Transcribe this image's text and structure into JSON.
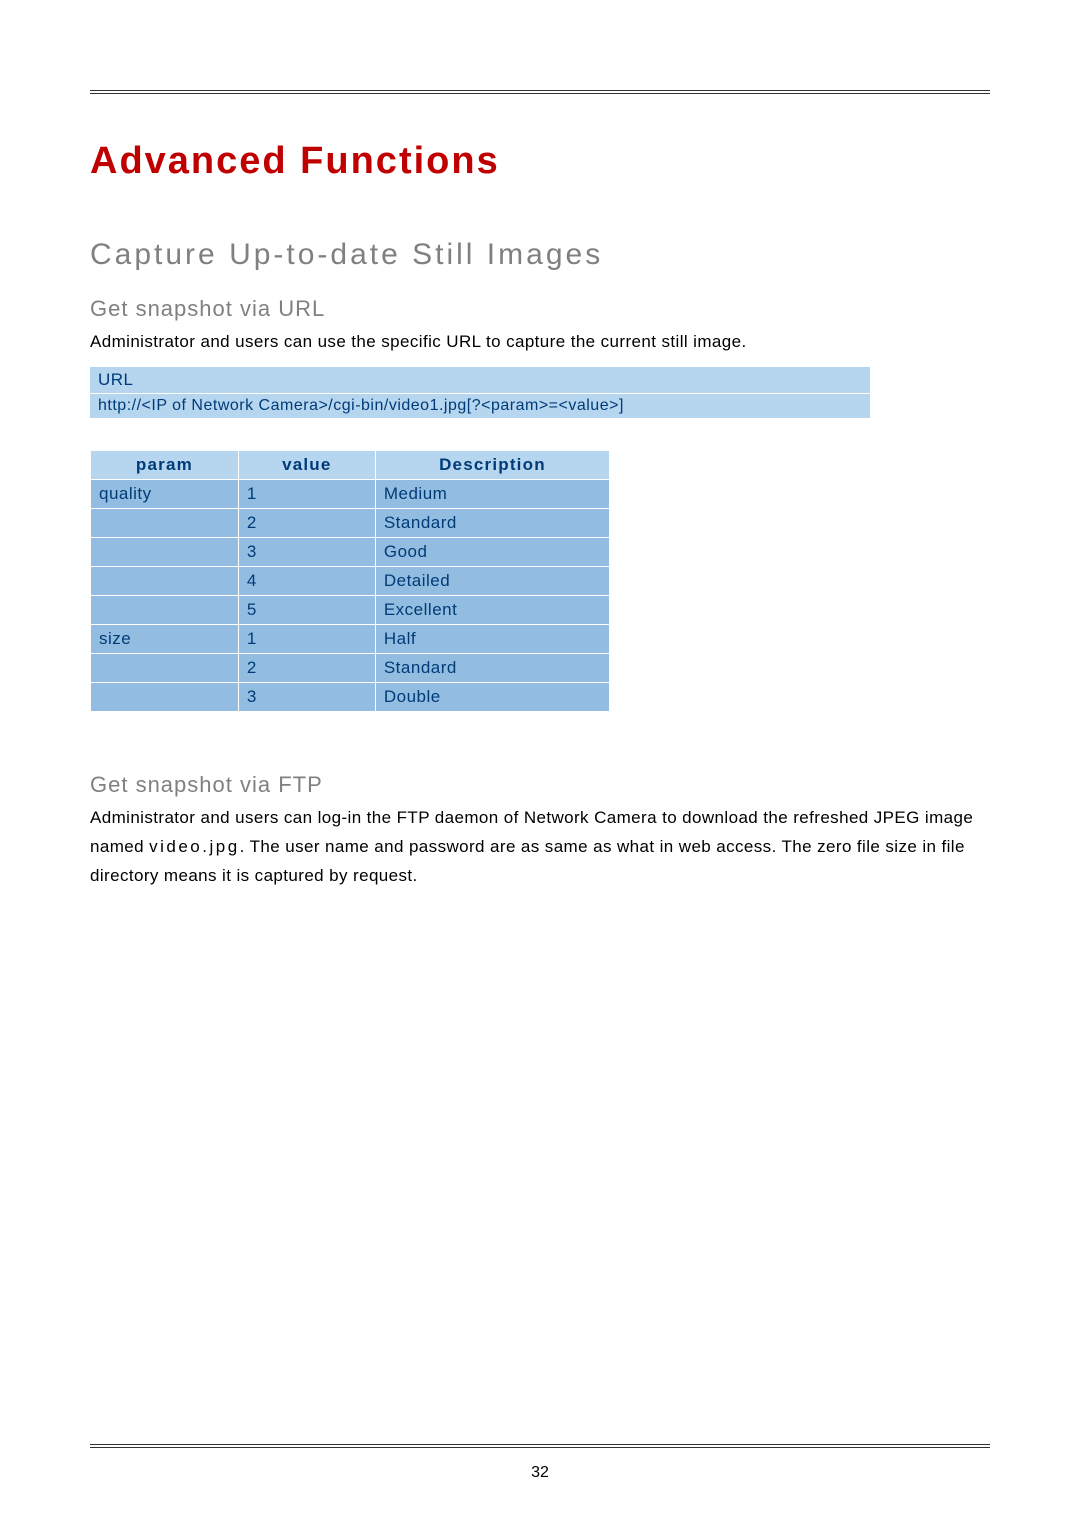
{
  "title": "Advanced Functions",
  "subtitle": "Capture Up-to-date Still Images",
  "section_url": {
    "heading": "Get snapshot via URL",
    "intro": "Administrator and users can use the specific URL to capture the current still image.",
    "url_label": "URL",
    "url_text": "http://<IP of Network Camera>/cgi-bin/video1.jpg[?<param>=<value>]"
  },
  "param_table": {
    "headers": {
      "param": "param",
      "value": "value",
      "description": "Description"
    },
    "rows": [
      {
        "param": "quality",
        "value": "1",
        "description": "Medium"
      },
      {
        "param": "",
        "value": "2",
        "description": "Standard"
      },
      {
        "param": "",
        "value": "3",
        "description": "Good"
      },
      {
        "param": "",
        "value": "4",
        "description": "Detailed"
      },
      {
        "param": "",
        "value": "5",
        "description": "Excellent"
      },
      {
        "param": "size",
        "value": "1",
        "description": "Half"
      },
      {
        "param": "",
        "value": "2",
        "description": "Standard"
      },
      {
        "param": "",
        "value": "3",
        "description": "Double"
      }
    ]
  },
  "section_ftp": {
    "heading": "Get snapshot via FTP",
    "para_prefix": "Administrator and users can log-in the FTP daemon of Network Camera to download the refreshed JPEG image named ",
    "file": "video.jpg",
    "para_suffix": ". The user name and password are as same as what in web access. The zero file size in file directory means it is captured by request."
  },
  "page_number": "32"
}
